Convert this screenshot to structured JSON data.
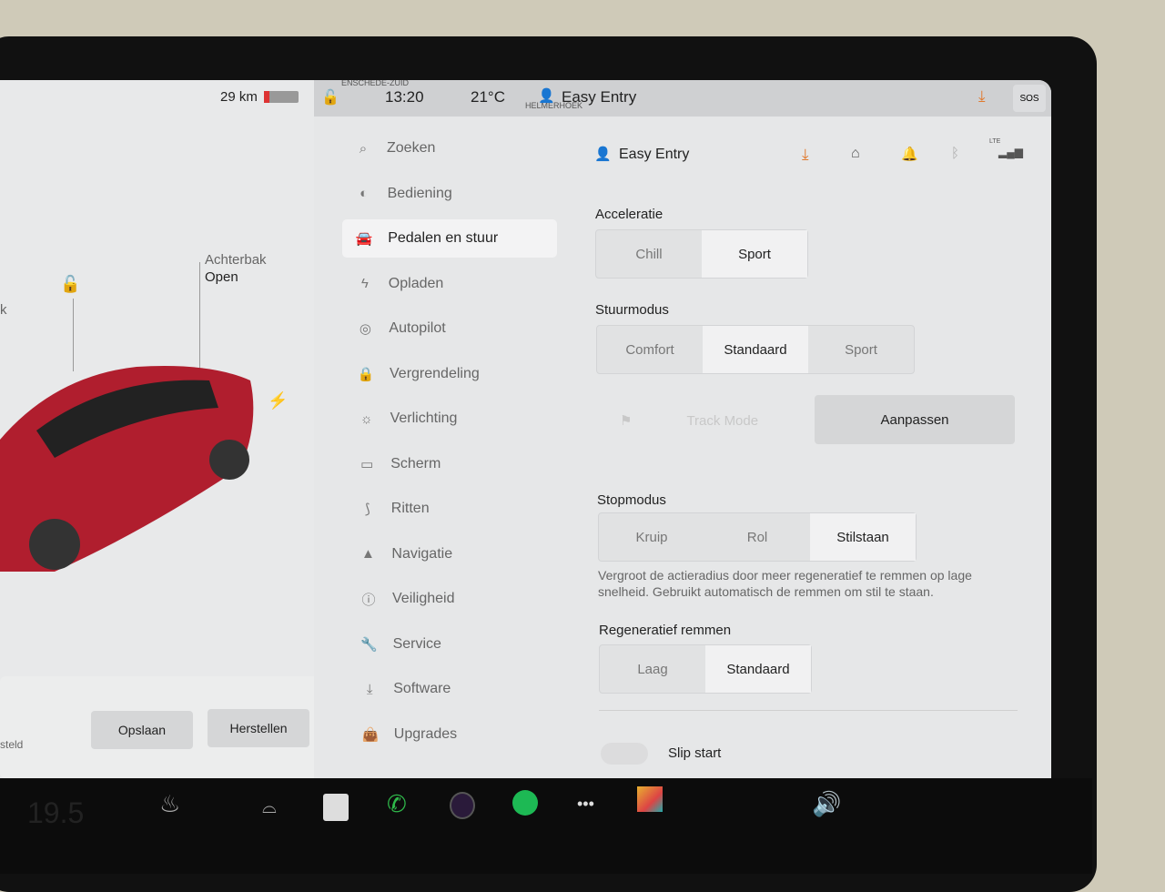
{
  "left_panel": {
    "range": "29 km",
    "trunk_label": "Achterbak",
    "trunk_state": "Open",
    "partial_left": "k",
    "partial_status": "steld",
    "save_button": "Opslaan",
    "reset_button": "Herstellen"
  },
  "status_bar": {
    "location_top": "ENSCHEDE-ZUID",
    "location_mid": "HELMERHOEK",
    "time": "13:20",
    "temperature": "21°C",
    "profile": "Easy Entry",
    "sos": "SOS"
  },
  "header": {
    "profile": "Easy Entry",
    "lte": "LTE",
    "accent": "#e07a2f"
  },
  "nav": [
    {
      "label": "Zoeken",
      "icon": "search-icon"
    },
    {
      "label": "Bediening",
      "icon": "toggle-icon"
    },
    {
      "label": "Pedalen en stuur",
      "icon": "car-icon",
      "active": true
    },
    {
      "label": "Opladen",
      "icon": "bolt-icon"
    },
    {
      "label": "Autopilot",
      "icon": "steering-wheel-icon"
    },
    {
      "label": "Vergrendeling",
      "icon": "lock-icon"
    },
    {
      "label": "Verlichting",
      "icon": "light-icon"
    },
    {
      "label": "Scherm",
      "icon": "display-icon"
    },
    {
      "label": "Ritten",
      "icon": "trips-icon"
    },
    {
      "label": "Navigatie",
      "icon": "navigation-icon"
    },
    {
      "label": "Veiligheid",
      "icon": "safety-icon"
    },
    {
      "label": "Service",
      "icon": "wrench-icon"
    },
    {
      "label": "Software",
      "icon": "download-icon"
    },
    {
      "label": "Upgrades",
      "icon": "bag-icon"
    }
  ],
  "settings": {
    "acceleration": {
      "label": "Acceleratie",
      "options": [
        "Chill",
        "Sport"
      ],
      "selected": "Sport"
    },
    "steering": {
      "label": "Stuurmodus",
      "options": [
        "Comfort",
        "Standaard",
        "Sport"
      ],
      "selected": "Standaard"
    },
    "track_mode": "Track Mode",
    "customize": "Aanpassen",
    "stop_mode": {
      "label": "Stopmodus",
      "options": [
        "Kruip",
        "Rol",
        "Stilstaan"
      ],
      "selected": "Stilstaan",
      "description": "Vergroot de actieradius door meer regeneratief te remmen op lage snelheid. Gebruikt automatisch de remmen om stil te staan."
    },
    "regen": {
      "label": "Regeneratief remmen",
      "options": [
        "Laag",
        "Standaard"
      ],
      "selected": "Standaard"
    },
    "slip_start": {
      "label": "Slip start",
      "on": false
    }
  },
  "taskbar": {
    "cabin_temp": "19.5"
  }
}
